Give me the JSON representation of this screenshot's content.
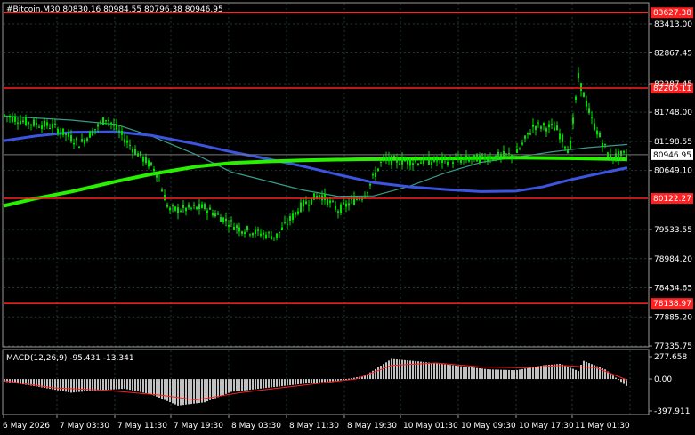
{
  "header": {
    "symbol_info": "#Bitcoin,M30  80830.16 80984.55 80796.38 80946.95"
  },
  "price_axis": {
    "ticks": [
      "83413.00",
      "82867.45",
      "82287.45",
      "81748.00",
      "81198.55",
      "80649.10",
      "79533.55",
      "78984.20",
      "78434.65",
      "77885.20",
      "77335.75"
    ]
  },
  "levels": [
    {
      "label": "83627.38",
      "value": 83627.38,
      "color": "#ff2020"
    },
    {
      "label": "82205.11",
      "value": 82205.11,
      "color": "#ff2020"
    },
    {
      "label": "80122.27",
      "value": 80122.27,
      "color": "#ff2020"
    },
    {
      "label": "78138.97",
      "value": 78138.97,
      "color": "#ff2020"
    }
  ],
  "current_price": {
    "label": "80946.95",
    "value": 80946.95
  },
  "macd": {
    "label": "MACD(12,26,9) -95.431 -13.341",
    "ticks": [
      "277.658",
      "0.00",
      "-397.911"
    ]
  },
  "time_axis": {
    "labels": [
      "6 May 2026",
      "7 May 03:30",
      "7 May 11:30",
      "7 May 19:30",
      "8 May 03:30",
      "8 May 11:30",
      "8 May 19:30",
      "10 May 01:30",
      "10 May 09:30",
      "10 May 17:30",
      "11 May 01:30"
    ]
  },
  "colors": {
    "background": "#000000",
    "grid": "#1e3a32",
    "candle": "#00e000",
    "ma_fast": "#3a9a8a",
    "ma_mid": "#3c55e0",
    "ma_slow": "#28f000",
    "level": "#ff2020",
    "macd_hist": "#c0c0c0",
    "macd_signal": "#ff2020"
  }
}
